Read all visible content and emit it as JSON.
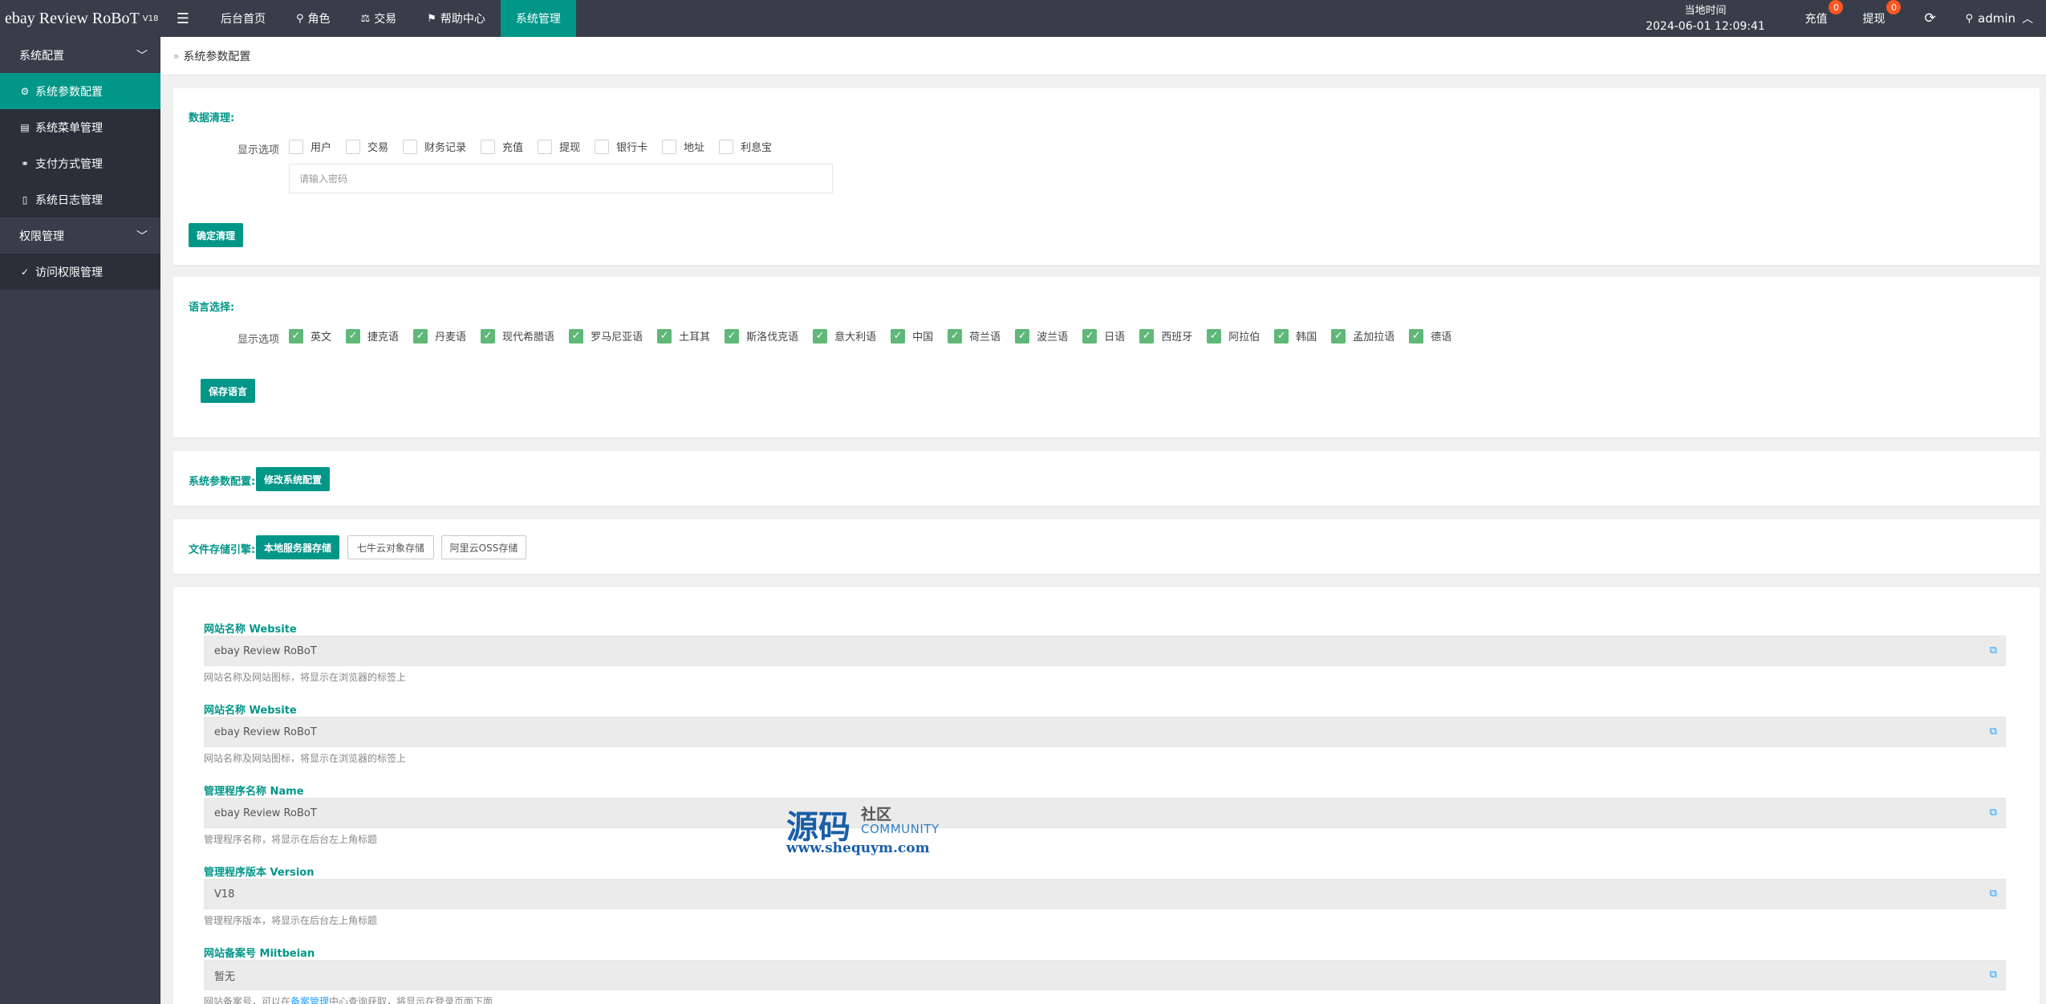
{
  "app": {
    "title": "ebay Review RoBoT",
    "version": "V18"
  },
  "topnav": {
    "items": [
      {
        "label": "后台首页",
        "icon": ""
      },
      {
        "label": "角色",
        "icon": "user-icon"
      },
      {
        "label": "交易",
        "icon": "scale-icon"
      },
      {
        "label": "帮助中心",
        "icon": "flag-icon"
      },
      {
        "label": "系统管理",
        "icon": ""
      }
    ],
    "active_index": 4,
    "accent_color": "#009688"
  },
  "header_right": {
    "clock_label": "当地时间",
    "clock_value": "2024-06-01 12:09:41",
    "recharge_label": "充值",
    "recharge_badge": "0",
    "withdraw_label": "提现",
    "withdraw_badge": "0",
    "user_name": "admin"
  },
  "sidebar": {
    "group1": "系统配置",
    "items1": [
      "系统参数配置",
      "系统菜单管理",
      "支付方式管理",
      "系统日志管理"
    ],
    "group2": "权限管理",
    "items2": [
      "访问权限管理"
    ]
  },
  "breadcrumb": "系统参数配置",
  "data_clean": {
    "title": "数据清理:",
    "row_label": "显示选项",
    "options": [
      "用户",
      "交易",
      "财务记录",
      "充值",
      "提现",
      "银行卡",
      "地址",
      "利息宝"
    ],
    "password_placeholder": "请输入密码",
    "confirm_button": "确定清理"
  },
  "language": {
    "title": "语言选择:",
    "row_label": "显示选项",
    "options": [
      "英文",
      "捷克语",
      "丹麦语",
      "现代希腊语",
      "罗马尼亚语",
      "土耳其",
      "斯洛伐克语",
      "意大利语",
      "中国",
      "荷兰语",
      "波兰语",
      "日语",
      "西班牙",
      "阿拉伯",
      "韩国",
      "孟加拉语",
      "德语"
    ],
    "all_checked": true,
    "save_button": "保存语言"
  },
  "sys_params": {
    "title": "系统参数配置:",
    "button": "修改系统配置"
  },
  "storage": {
    "title": "文件存储引擎:",
    "options": [
      "本地服务器存储",
      "七牛云对象存储",
      "阿里云OSS存储"
    ],
    "active_index": 0
  },
  "fields": [
    {
      "label": "网站名称 Website",
      "value": "ebay Review RoBoT",
      "help": "网站名称及网站图标，将显示在浏览器的标签上"
    },
    {
      "label": "网站名称 Website",
      "value": "ebay Review RoBoT",
      "help": "网站名称及网站图标，将显示在浏览器的标签上"
    },
    {
      "label": "管理程序名称 Name",
      "value": "ebay Review RoBoT",
      "help": "管理程序名称，将显示在后台左上角标题"
    },
    {
      "label": "管理程序版本 Version",
      "value": "V18",
      "help": "管理程序版本，将显示在后台左上角标题"
    },
    {
      "label": "网站备案号 Miitbeian",
      "value": "暂无",
      "help_prefix": "网站备案号，可以在",
      "help_link": "备案管理",
      "help_suffix": "中心查询获取，将显示在登录页面下面"
    }
  ],
  "watermark": {
    "big": "源码",
    "small_top": "社区",
    "small_bottom": "COMMUNITY",
    "url": "www.shequym.com"
  }
}
